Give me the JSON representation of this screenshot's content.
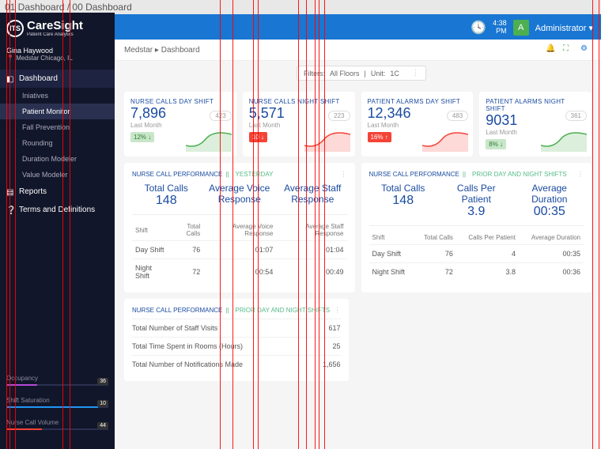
{
  "page_title": "01 Dashboard / 00 Dashboard",
  "header": {
    "time": "4:38",
    "ampm": "PM",
    "avatar_initial": "A",
    "role": "Administrator",
    "dropdown": "▾"
  },
  "brand": {
    "logo_text": "ITS",
    "name": "CareSight",
    "sub": "Patient Care Analytics"
  },
  "user": {
    "name": "Gina Haywood",
    "location": "Medstar Chicago, IL"
  },
  "nav": {
    "dashboard": "Dashboard",
    "subs": [
      "Iniatives",
      "Patient Monitor",
      "Fall Prevention",
      "Rounding",
      "Duration Modeler",
      "Value Modeler"
    ],
    "reports": "Reports",
    "terms": "Terms and Definitions"
  },
  "meters": [
    {
      "label": "Occupancy",
      "val": "36",
      "pct": 30,
      "color": "#b34bd6"
    },
    {
      "label": "Shift Saturation",
      "val": "10",
      "pct": 90,
      "color": "#2196f3"
    },
    {
      "label": "Nurse Call Volume",
      "val": "44",
      "pct": 35,
      "color": "#f44336"
    }
  ],
  "breadcrumb": {
    "root": "Medstar",
    "sep": "▸",
    "current": "Dashboard"
  },
  "filters": {
    "label": "Filters:",
    "floors": "All Floors",
    "unit_label": "Unit:",
    "unit": "1C"
  },
  "kpis": [
    {
      "title": "NURSE CALLS DAY SHIFT",
      "val": "7,896",
      "sub": "Last Month",
      "badge": "12%",
      "arrow": "↓",
      "pill": "423",
      "cls": "bg-grn",
      "spark": "grn"
    },
    {
      "title": "NURSE CALLS NIGHT SHIFT",
      "val": "5,571",
      "sub": "Last Month",
      "badge": "10",
      "arrow": "↓",
      "pill": "223",
      "cls": "bg-red",
      "spark": "red"
    },
    {
      "title": "PATIENT ALARMS DAY SHIFT",
      "val": "12,346",
      "sub": "Last Month",
      "badge": "16%",
      "arrow": "↑",
      "pill": "483",
      "cls": "bg-red",
      "spark": "red"
    },
    {
      "title": "PATIENT ALARMS NIGHT SHIFT",
      "val": "9031",
      "sub": "Last Month",
      "badge": "8%",
      "arrow": "↓",
      "pill": "361",
      "cls": "bg-grn",
      "spark": "grn"
    }
  ],
  "panelA": {
    "title": "NURSE CALL PERFORMANCE",
    "tag": "YESTERDAY",
    "metrics": [
      {
        "label": "Total Calls",
        "val": "148"
      },
      {
        "label": "Average Voice Response",
        "val": ""
      },
      {
        "label": "Average Staff Response",
        "val": ""
      }
    ],
    "th": [
      "Shift",
      "Total Calls",
      "Average Voice Response",
      "Average Staff Response"
    ],
    "rows": [
      [
        "Day Shift",
        "76",
        "01:07",
        "01:04"
      ],
      [
        "Night Shift",
        "72",
        "00:54",
        "00:49"
      ]
    ]
  },
  "panelB": {
    "title": "NURSE CALL PERFORMANCE",
    "tag": "PRIOR DAY AND NIGHT SHIFTS",
    "metrics": [
      {
        "label": "Total Calls",
        "val": "148"
      },
      {
        "label": "Calls Per Patient",
        "val": "3.9"
      },
      {
        "label": "Average Duration",
        "val": "00:35"
      }
    ],
    "th": [
      "Shift",
      "Total Calls",
      "Calls Per Patient",
      "Average Duration"
    ],
    "rows": [
      [
        "Day Shift",
        "76",
        "4",
        "00:35"
      ],
      [
        "Night Shift",
        "72",
        "3.8",
        "00:36"
      ]
    ]
  },
  "panelC": {
    "title": "NURSE CALL PERFORMANCE",
    "tag": "PRIOR DAY AND NIGHT SHIFTS",
    "kv": [
      [
        "Total Number of Staff Visits",
        "617"
      ],
      [
        "Total Time Spent in Rooms (Hours)",
        "25"
      ],
      [
        "Total Number of Notifications Made",
        "1,656"
      ]
    ]
  },
  "redlines": [
    8,
    12,
    19,
    79,
    88,
    278,
    294,
    320,
    326,
    377,
    387,
    398,
    403,
    410,
    749,
    757
  ]
}
